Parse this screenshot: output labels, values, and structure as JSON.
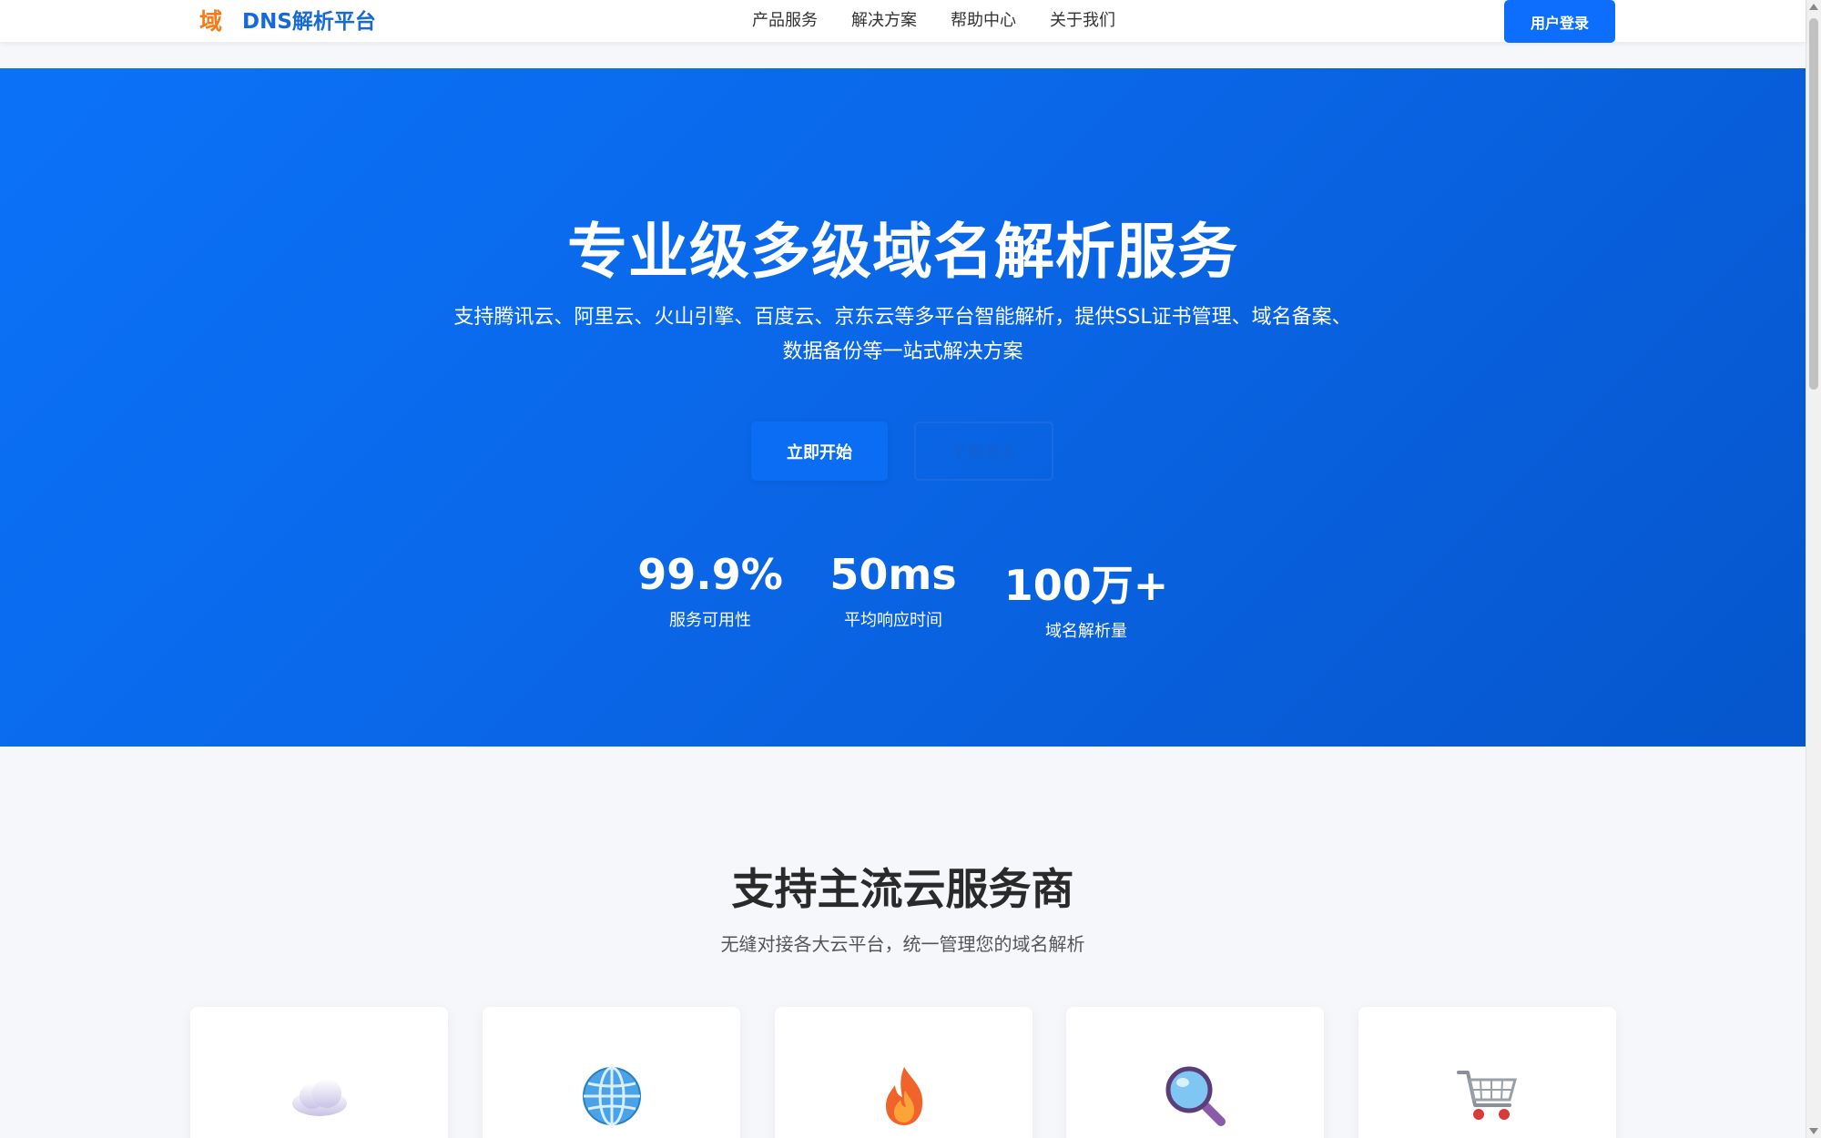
{
  "nav": {
    "brand_icon": "域",
    "brand_name": "DNS解析平台",
    "links": [
      "产品服务",
      "解决方案",
      "帮助中心",
      "关于我们"
    ],
    "login_label": "用户登录"
  },
  "hero": {
    "title": "专业级多级域名解析服务",
    "subtitle_line1": "支持腾讯云、阿里云、火山引擎、百度云、京东云等多平台智能解析，提供SSL证书管理、域名备案、",
    "subtitle_line2": "数据备份等一站式解决方案",
    "start_label": "立即开始",
    "more_label": "了解更多",
    "stats": [
      {
        "value": "99.9%",
        "label": "服务可用性"
      },
      {
        "value": "50ms",
        "label": "平均响应时间"
      },
      {
        "value": "100万+",
        "label": "域名解析量"
      }
    ]
  },
  "providers": {
    "title": "支持主流云服务商",
    "subtitle": "无缝对接各大云平台，统一管理您的域名解析",
    "cards": [
      {
        "icon": "cloud-icon"
      },
      {
        "icon": "globe-icon"
      },
      {
        "icon": "fire-icon"
      },
      {
        "icon": "magnifier-icon"
      },
      {
        "icon": "shopping-cart-icon"
      }
    ]
  },
  "colors": {
    "primary": "#0d6efd",
    "hero_start": "#0b72f8",
    "hero_end": "#0656cc",
    "brand_text": "#1669d9",
    "brand_icon": "#f07d17"
  }
}
